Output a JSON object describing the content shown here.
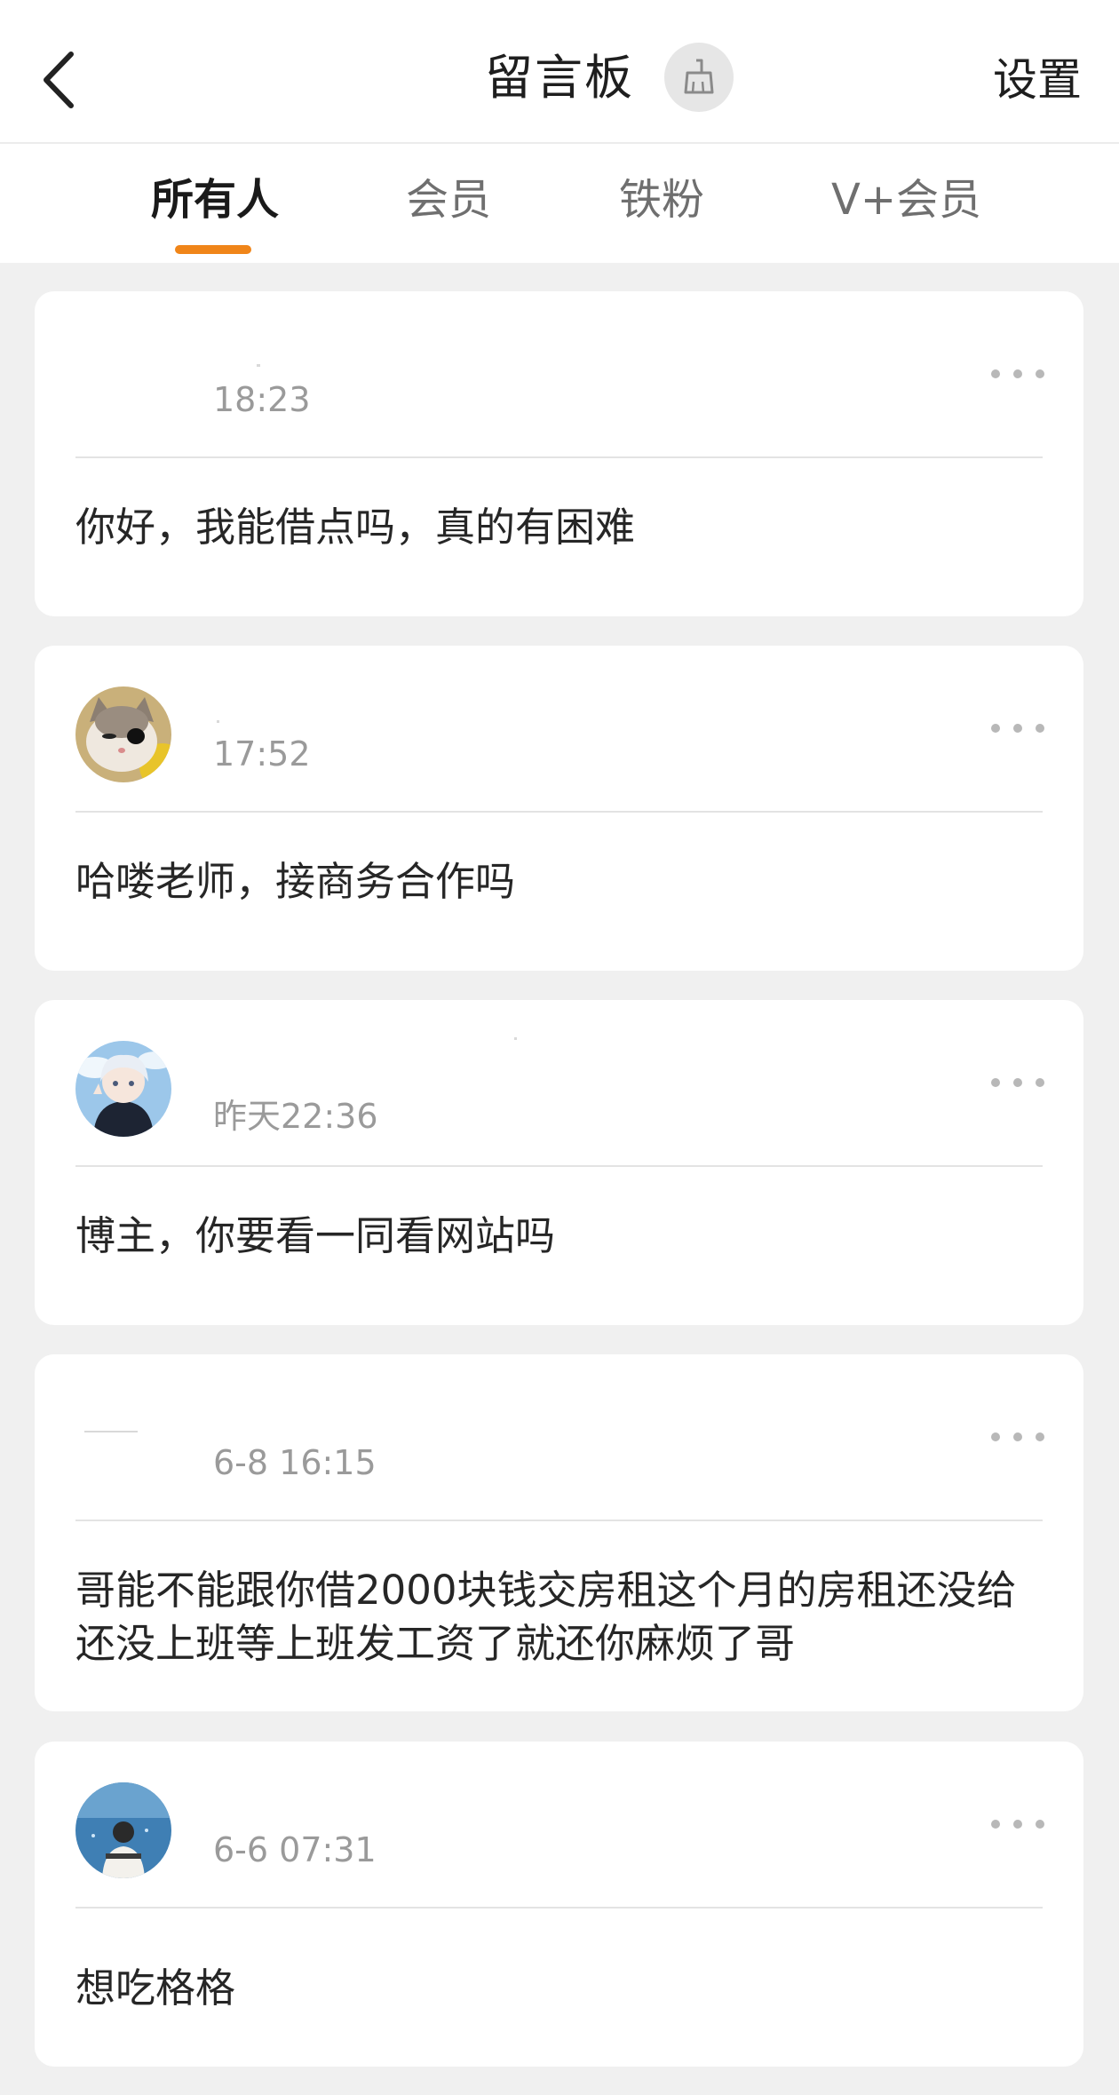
{
  "header": {
    "title": "留言板",
    "settings_label": "设置"
  },
  "tabs": [
    {
      "label": "所有人",
      "active": true
    },
    {
      "label": "会员",
      "active": false
    },
    {
      "label": "铁粉",
      "active": false
    },
    {
      "label": "V+会员",
      "active": false
    }
  ],
  "accent_color": "#f08519",
  "messages": [
    {
      "time": "18:23",
      "text": "你好，我能借点吗，真的有困难",
      "avatar": "none"
    },
    {
      "time": "17:52",
      "text": "哈喽老师，接商务合作吗",
      "avatar": "cat"
    },
    {
      "time": "昨天22:36",
      "text": "博主，你要看一同看网站吗",
      "avatar": "anime-boy"
    },
    {
      "time": "6-8 16:15",
      "text": "哥能不能跟你借2000块钱交房租这个月的房租还没给还没上班等上班发工资了就还你麻烦了哥",
      "avatar": "none"
    },
    {
      "time": "6-6 07:31",
      "text": "想吃格格",
      "avatar": "sea-photo"
    }
  ]
}
